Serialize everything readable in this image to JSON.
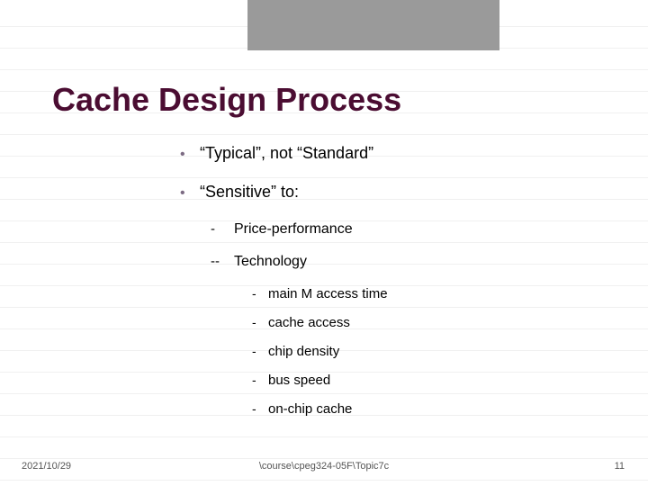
{
  "title": "Cache Design Process",
  "bullets": {
    "b0": "“Typical”, not “Standard”",
    "b1": "“Sensitive” to:",
    "s0_marker": "-",
    "s0": "Price-performance",
    "s1_marker": "--",
    "s1": "Technology",
    "t0": "main M access time",
    "t1": "cache access",
    "t2": "chip density",
    "t3": "bus speed",
    "t4": "on-chip cache"
  },
  "footer": {
    "date": "2021/10/29",
    "path": "\\course\\cpeg324-05F\\Topic7c",
    "pagenum": "11"
  }
}
